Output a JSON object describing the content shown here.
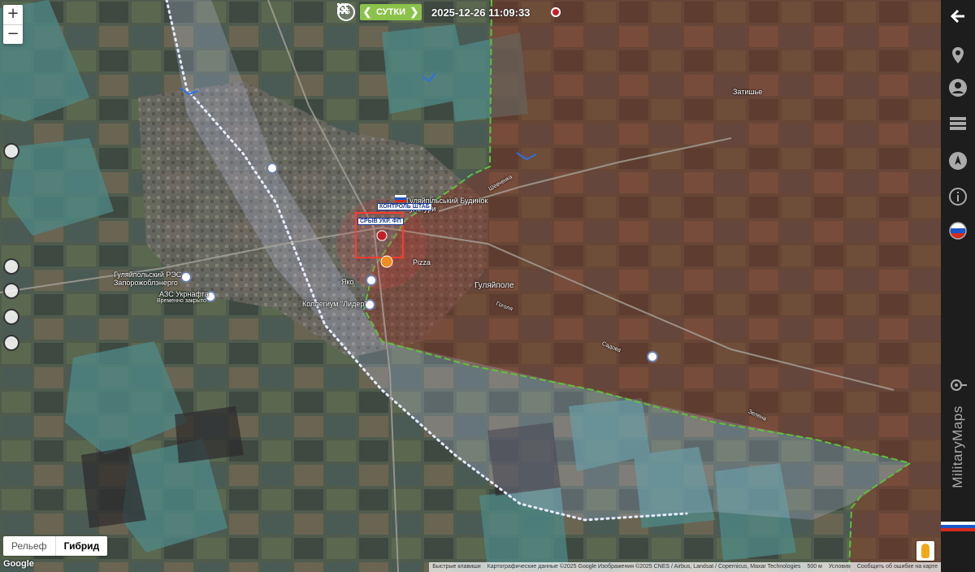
{
  "toolbar": {
    "recenter_label": "F5",
    "period_label": "СУТКИ",
    "prev_arrow": "❮",
    "next_arrow": "❯",
    "datetime": "2025-12-26 11:09:33"
  },
  "zoom": {
    "in": "+",
    "out": "−"
  },
  "map_type": {
    "relief": "Рельеф",
    "hybrid": "Гибрид",
    "active": "hybrid"
  },
  "google_logo": "Google",
  "places": [
    {
      "id": "zatyshshia",
      "name": "Затишье"
    },
    {
      "id": "huliaipole",
      "name": "Гуляйполе"
    },
    {
      "id": "rps",
      "name": "Гуляйпольский РЭС Запорожоблэнерго"
    },
    {
      "id": "azs",
      "name": "АЗС Укрнафта"
    },
    {
      "id": "azs_status",
      "name": "Временно закрыто"
    },
    {
      "id": "college",
      "name": "Коллегиум \"Лидер\""
    },
    {
      "id": "pizza",
      "name": "Pizza"
    },
    {
      "id": "yako",
      "name": "Яко"
    },
    {
      "id": "palace",
      "name": "Гуляйпільський Будинок культури"
    },
    {
      "id": "street_1",
      "name": "Шевченка"
    },
    {
      "id": "street_2",
      "name": "Гоголя"
    },
    {
      "id": "street_3",
      "name": "Садова"
    },
    {
      "id": "street_4",
      "name": "Зелена"
    }
  ],
  "unit_labels": [
    {
      "id": "hq",
      "text": "КОНТРОЛЬ ШТАБ"
    },
    {
      "id": "ukr",
      "text": "СРЫВ УКР. ФП"
    }
  ],
  "attribution": {
    "shortcuts": "Быстрые клавиши",
    "data": "Картографические данные ©2025 Google Изображения ©2025 CNES / Airbus, Landsat / Copernicus, Maxar Technologies",
    "scale": "500 м",
    "terms": "Условия",
    "report": "Сообщить об ошибке на карте"
  },
  "sidebar": {
    "brand": "MilitaryMaps",
    "items": [
      "back-icon",
      "location-pin-icon",
      "user-icon",
      "layers-icon",
      "compass-icon",
      "info-icon",
      "russia-flag-icon",
      "crosshair-icon"
    ]
  },
  "colors": {
    "occupied_fill": "#8b2a1a",
    "front_line": "#5fc03a",
    "grey_zone": "#cfd8ff",
    "period_green": "#8bc34a",
    "sidebar_bg": "#1d1d1d"
  }
}
